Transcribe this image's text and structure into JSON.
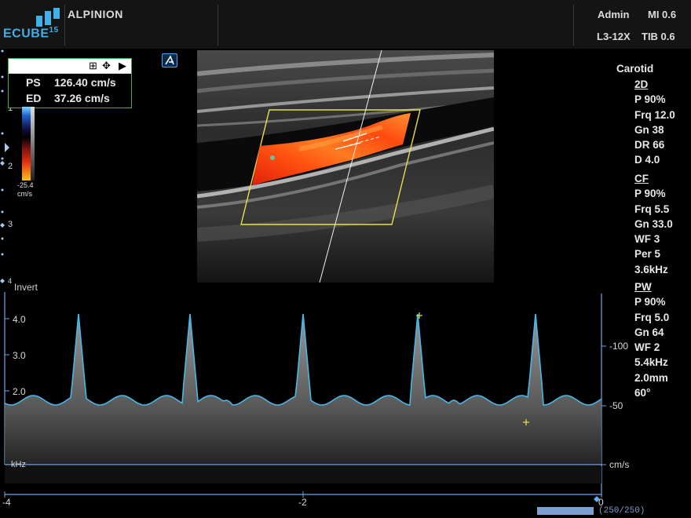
{
  "header": {
    "brand": "ALPINION",
    "logo_text": "ECUBE",
    "logo_num": "15",
    "user": "Admin",
    "mi": "MI 0.6",
    "probe": "L3-12X",
    "tib": "TIB 0.6"
  },
  "measurement": {
    "ps_label": "PS",
    "ps_value": "126.40 cm/s",
    "ed_label": "ED",
    "ed_value": "37.26 cm/s"
  },
  "colorbar": {
    "value": "-25.4",
    "unit": "cm/s"
  },
  "depth_marks": [
    "1",
    "2",
    "3",
    "4"
  ],
  "right_panel": {
    "preset": "Carotid",
    "sections": [
      {
        "title": "2D",
        "items": [
          "P 90%",
          "Frq 12.0",
          "Gn 38",
          "DR 66",
          "D 4.0"
        ]
      },
      {
        "title": "CF",
        "items": [
          "P 90%",
          "Frq 5.5",
          "Gn 33.0",
          "WF 3",
          "Per 5",
          "3.6kHz"
        ]
      },
      {
        "title": "PW",
        "items": [
          "P 90%",
          "Frq 5.0",
          "Gn 64",
          "WF 2",
          "5.4kHz",
          "2.0mm",
          "60°"
        ]
      }
    ]
  },
  "spectral": {
    "invert_label": "Invert",
    "left_ticks": [
      "4.0",
      "3.0",
      "2.0"
    ],
    "left_unit": "kHz",
    "right_ticks": [
      "-100",
      "-50"
    ],
    "right_unit": "cm/s",
    "time_ticks": [
      "-4",
      "-2",
      "0"
    ]
  },
  "cine": {
    "label": "(250/250)"
  },
  "colors": {
    "accent": "#3fb0e8",
    "trace": "#48b8e8",
    "sample_box": "#e8e050",
    "meas_border": "#3fb04a"
  }
}
